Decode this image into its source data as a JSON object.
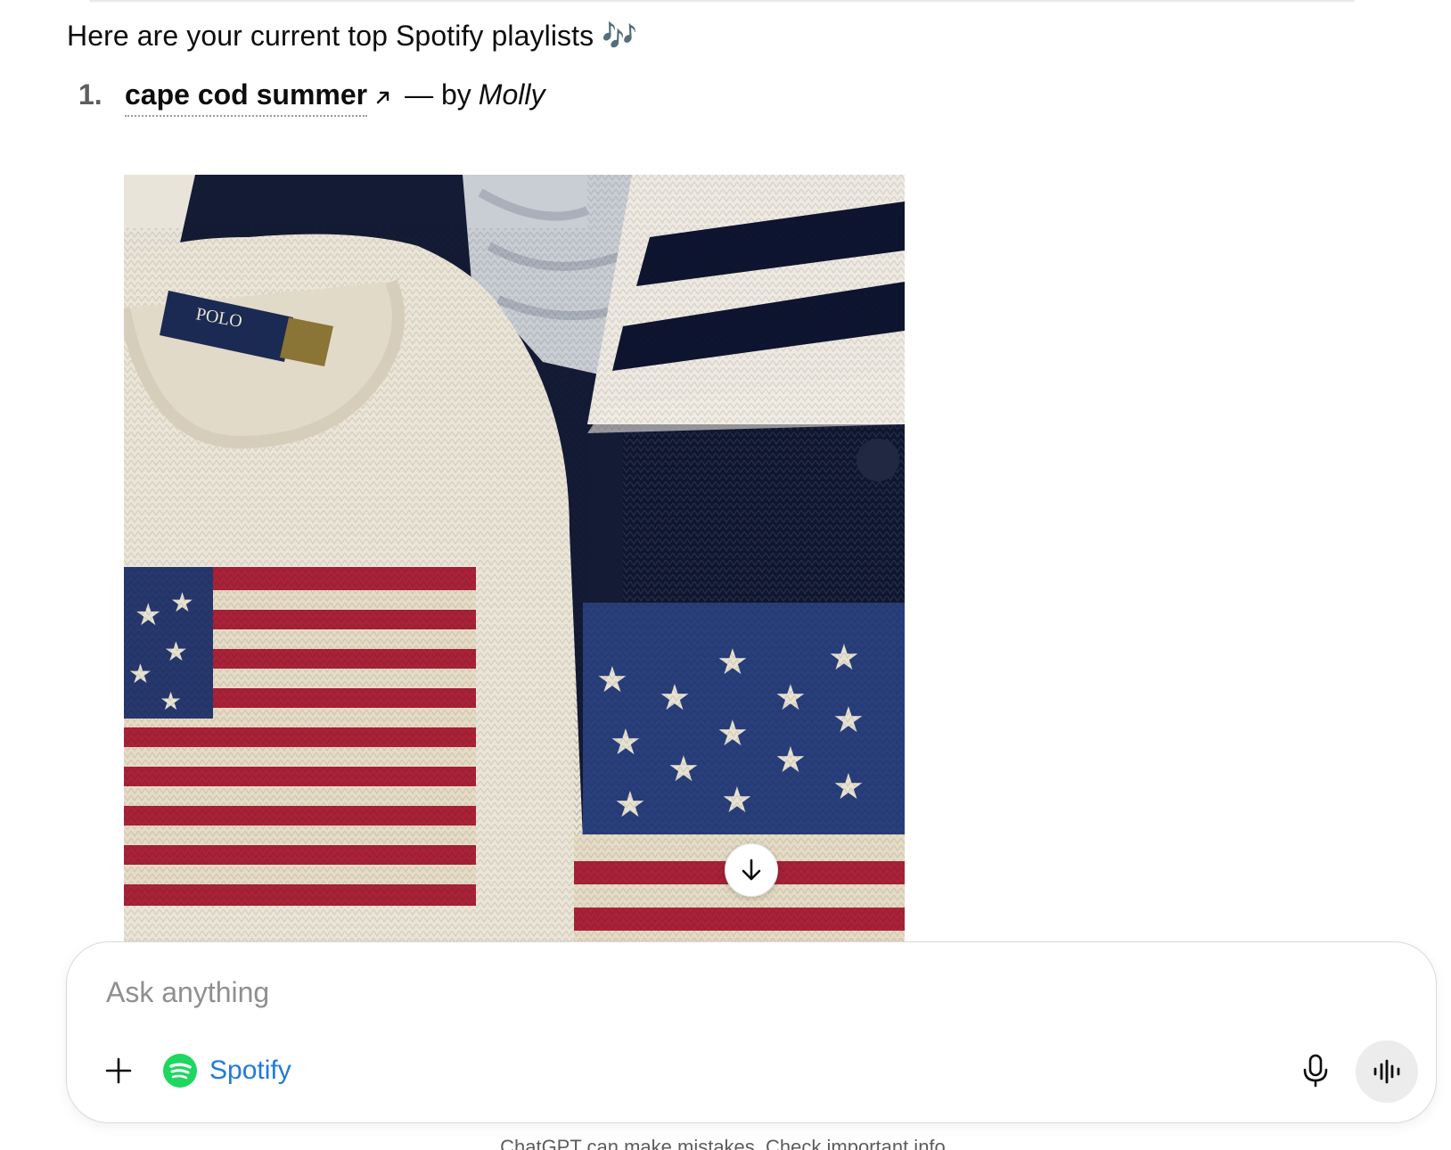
{
  "message": {
    "intro": "Here are your current top Spotify playlists 🎶",
    "playlists": [
      {
        "number": "1.",
        "title": "cape cod summer",
        "separator": "— by",
        "author": "Molly"
      }
    ]
  },
  "composer": {
    "placeholder": "Ask anything",
    "connector_label": "Spotify",
    "icons": [
      "plus-icon",
      "spotify-logo-icon",
      "microphone-icon",
      "voice-waveform-icon"
    ]
  },
  "scroll_button": {
    "icon": "arrow-down-icon"
  },
  "footer": {
    "disclaimer": "ChatGPT can make mistakes. Check important info."
  },
  "colors": {
    "link_blue": "#1f7ae0",
    "spotify_green": "#1ed760",
    "voice_button_bg": "#ececec"
  }
}
